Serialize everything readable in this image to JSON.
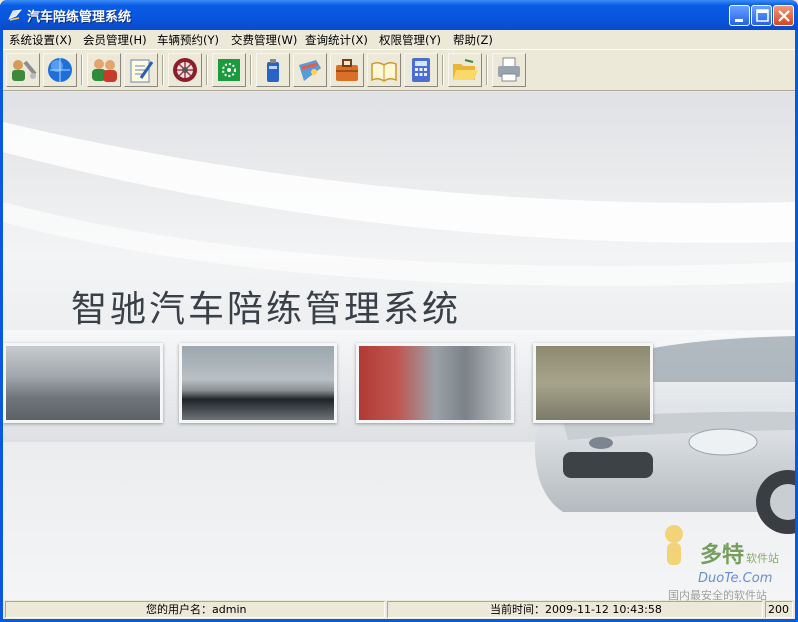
{
  "window": {
    "title": "汽车陪练管理系统"
  },
  "menu": [
    {
      "label": "系统设置(X)"
    },
    {
      "label": "会员管理(H)"
    },
    {
      "label": "车辆预约(Y)"
    },
    {
      "label": "交费管理(W)"
    },
    {
      "label": "查询统计(X)"
    },
    {
      "label": "权限管理(Y)"
    },
    {
      "label": "帮助(Z)"
    }
  ],
  "toolbar": [
    {
      "icon": "users-tools-icon"
    },
    {
      "icon": "globe-icon"
    },
    {
      "icon": "members-icon"
    },
    {
      "icon": "edit-note-icon"
    },
    {
      "icon": "wheel-icon"
    },
    {
      "icon": "settings-grid-icon"
    },
    {
      "icon": "battery-icon"
    },
    {
      "icon": "wallet-icon"
    },
    {
      "icon": "briefcase-icon"
    },
    {
      "icon": "book-icon"
    },
    {
      "icon": "calculator-icon"
    },
    {
      "icon": "folder-open-icon"
    },
    {
      "icon": "printer-icon"
    }
  ],
  "banner": {
    "title": "智驰汽车陪练管理系统"
  },
  "status": {
    "user_label": "您的用户名：admin",
    "time_label": "当前时间：2009-11-12 10:43:58",
    "extra": "200"
  },
  "watermark": {
    "brand": "多特",
    "sub": "软件站",
    "domain": "DuoTe.Com",
    "slogan": "国内最安全的软件站"
  },
  "colors": {
    "titlebar": "#0a5ce6",
    "chrome": "#ece9d8"
  }
}
